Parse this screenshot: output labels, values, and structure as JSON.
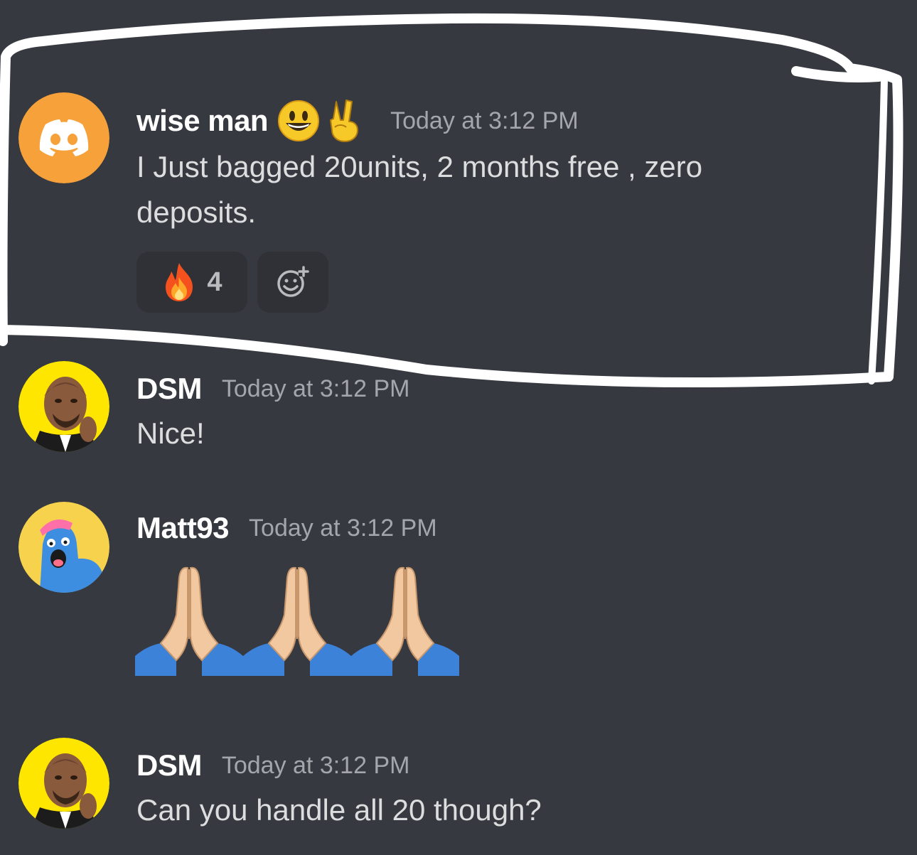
{
  "messages": [
    {
      "username": "wise man",
      "badges": [
        "smiley-emoji",
        "victory-hand-emoji"
      ],
      "timestamp": "Today at 3:12 PM",
      "text_line1": "I Just bagged 20units, 2 months free , zero",
      "text_line2": "deposits.",
      "avatar": "discord-logo-orange",
      "reactions": [
        {
          "emoji": "fire",
          "count": "4"
        }
      ],
      "add_reaction_icon": "add-reaction-icon"
    },
    {
      "username": "DSM",
      "timestamp": "Today at 3:12 PM",
      "text": "Nice!",
      "avatar": "yellow-portrait"
    },
    {
      "username": "Matt93",
      "timestamp": "Today at 3:12 PM",
      "content_emoji": [
        "folded-hands",
        "folded-hands",
        "folded-hands"
      ],
      "avatar": "blue-cartoon-creature"
    },
    {
      "username": "DSM",
      "timestamp": "Today at 3:12 PM",
      "text": "Can you handle all 20 though?",
      "avatar": "yellow-portrait"
    }
  ],
  "colors": {
    "background": "#36393f",
    "username": "#ffffff",
    "timestamp": "#a3a6aa",
    "message_text": "#dcddde",
    "reaction_bg": "#2f3136",
    "discord_avatar": "#f6a13a",
    "portrait_avatar": "#ffe600",
    "matt_avatar": "#f7d34d",
    "highlight_stroke": "#ffffff"
  },
  "annotation": "hand-drawn-white-highlight-outline"
}
